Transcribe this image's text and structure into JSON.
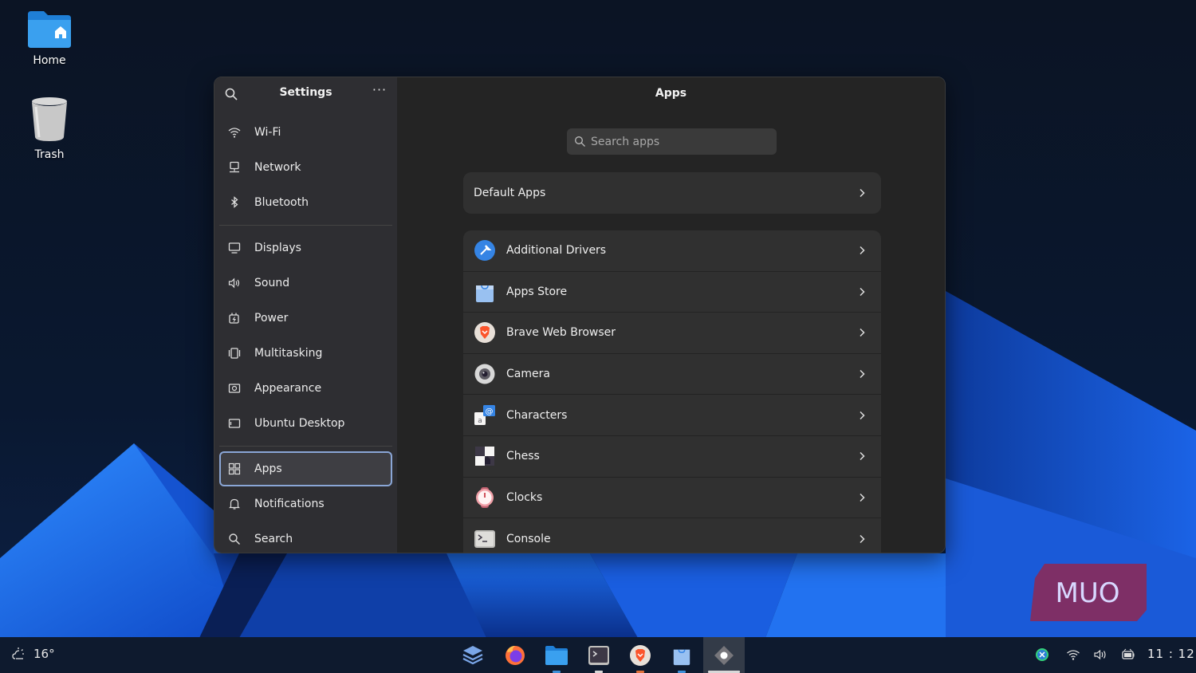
{
  "desktop": {
    "icons": [
      {
        "label": "Home"
      },
      {
        "label": "Trash"
      }
    ],
    "watermark": "MUO"
  },
  "window": {
    "sidebar": {
      "title": "Settings",
      "menu_label": "···",
      "groups": [
        [
          {
            "label": "Wi-Fi",
            "icon": "wifi-icon"
          },
          {
            "label": "Network",
            "icon": "network-icon"
          },
          {
            "label": "Bluetooth",
            "icon": "bluetooth-icon"
          }
        ],
        [
          {
            "label": "Displays",
            "icon": "display-icon"
          },
          {
            "label": "Sound",
            "icon": "sound-icon"
          },
          {
            "label": "Power",
            "icon": "power-icon"
          },
          {
            "label": "Multitasking",
            "icon": "multitasking-icon"
          },
          {
            "label": "Appearance",
            "icon": "appearance-icon"
          },
          {
            "label": "Ubuntu Desktop",
            "icon": "ubuntu-desktop-icon"
          }
        ],
        [
          {
            "label": "Apps",
            "icon": "apps-icon",
            "active": true
          },
          {
            "label": "Notifications",
            "icon": "bell-icon"
          },
          {
            "label": "Search",
            "icon": "search-icon"
          }
        ]
      ]
    },
    "main": {
      "title": "Apps",
      "search": {
        "placeholder": "Search apps"
      },
      "default_apps_label": "Default Apps",
      "apps": [
        {
          "label": "Additional Drivers",
          "icon": "additional-drivers-icon"
        },
        {
          "label": "Apps Store",
          "icon": "apps-store-icon"
        },
        {
          "label": "Brave Web Browser",
          "icon": "brave-icon"
        },
        {
          "label": "Camera",
          "icon": "camera-icon"
        },
        {
          "label": "Characters",
          "icon": "characters-icon"
        },
        {
          "label": "Chess",
          "icon": "chess-icon"
        },
        {
          "label": "Clocks",
          "icon": "clocks-icon"
        },
        {
          "label": "Console",
          "icon": "console-icon"
        }
      ]
    }
  },
  "taskbar": {
    "weather_temp": "16°",
    "clock": "11 : 12",
    "apps": [
      {
        "name": "layers-app-icon",
        "indicator": false
      },
      {
        "name": "firefox-icon",
        "indicator": false
      },
      {
        "name": "files-icon",
        "indicator": true,
        "indicator_color": "#3d8fd8"
      },
      {
        "name": "terminal-icon",
        "indicator": true,
        "indicator_color": "#d8d8d8"
      },
      {
        "name": "brave-icon",
        "indicator": true,
        "indicator_color": "#e0703a"
      },
      {
        "name": "app-store-icon",
        "indicator": true,
        "indicator_color": "#3d8fd8"
      },
      {
        "name": "settings-icon",
        "indicator": true,
        "indicator_color": "#d8d8d8",
        "active": true
      }
    ],
    "tray": [
      "sync-icon",
      "wifi-icon",
      "volume-icon",
      "battery-icon"
    ]
  },
  "colors": {
    "accent": "#8aa6d6",
    "window_bg": "#242424",
    "sidebar_bg": "#2e2e32",
    "card_bg": "#303030"
  }
}
